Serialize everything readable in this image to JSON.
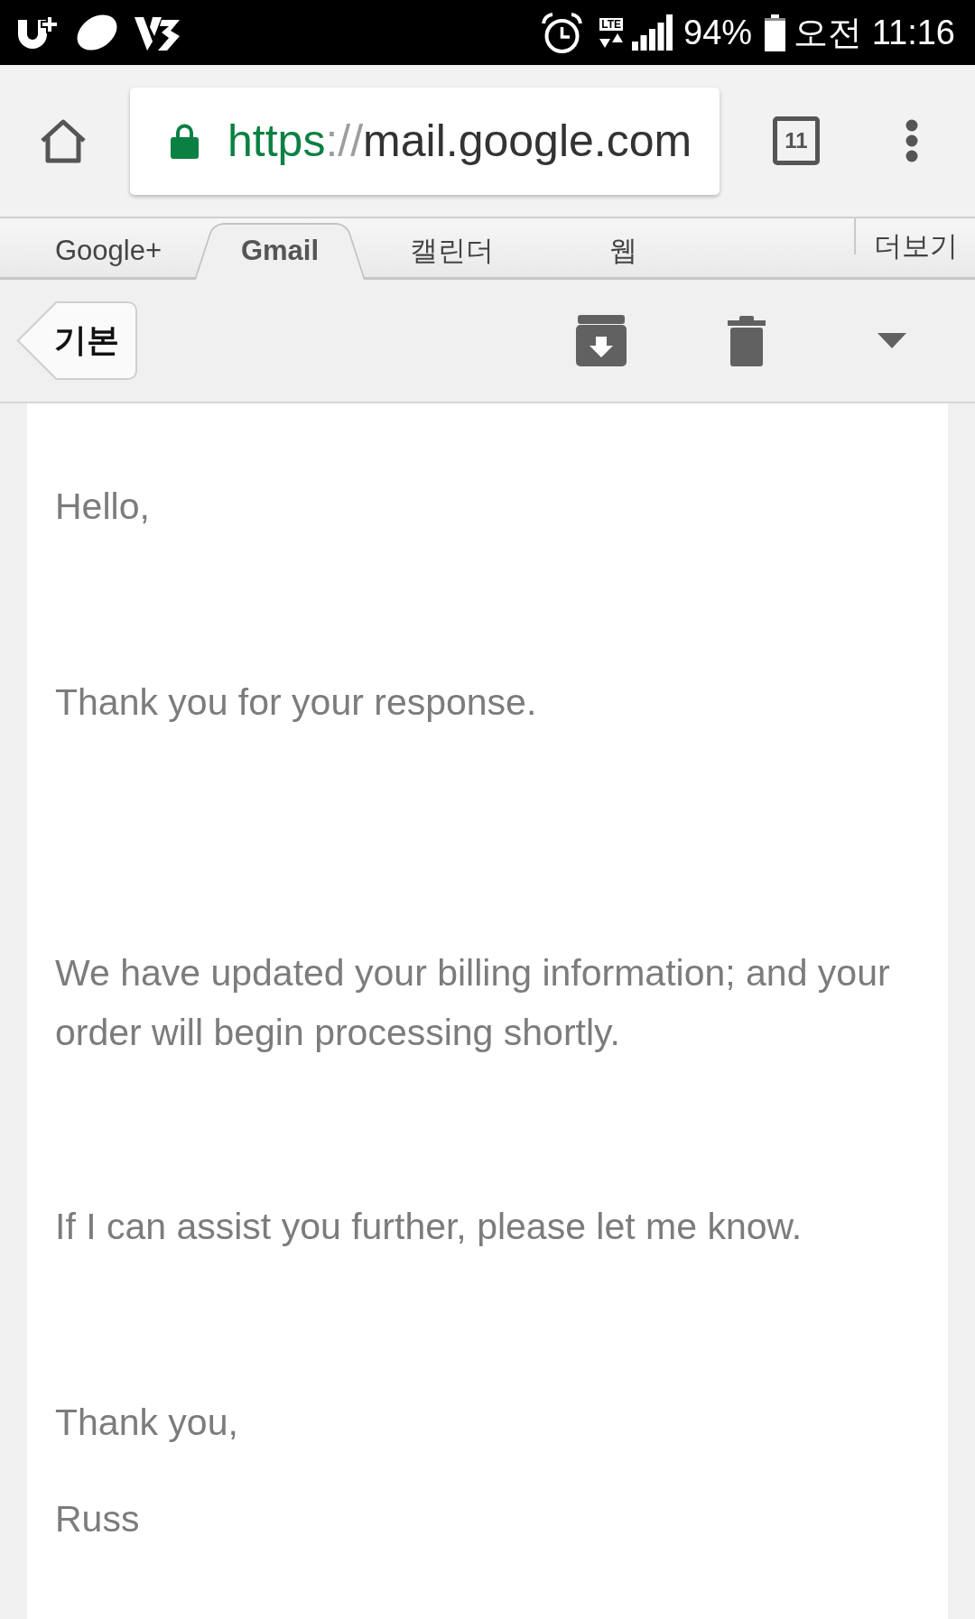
{
  "status_bar": {
    "network_type": "LTE",
    "battery_percent": "94%",
    "time": "오전 11:16"
  },
  "browser_toolbar": {
    "secure": true,
    "url_parts": [
      {
        "kind": "scheme",
        "text": "https"
      },
      {
        "kind": "separator",
        "text": "://"
      },
      {
        "kind": "host",
        "text": "mail.google.com"
      }
    ],
    "tab_count": "11"
  },
  "nav_tabs": {
    "tabs": [
      {
        "label": "Google+",
        "selected": false
      },
      {
        "label": "Gmail",
        "selected": true
      },
      {
        "label": "캘린더",
        "selected": false
      },
      {
        "label": "웹",
        "selected": false
      }
    ],
    "more": "더보기"
  },
  "mail_toolbar": {
    "back_label": "기본"
  },
  "email": {
    "paragraphs": [
      "Hello,",
      "Thank you for your response.",
      "We have updated your billing information; and your order will begin processing shortly.",
      "If I can assist you further, please let me know.",
      "Thank you,",
      "Russ"
    ]
  }
}
